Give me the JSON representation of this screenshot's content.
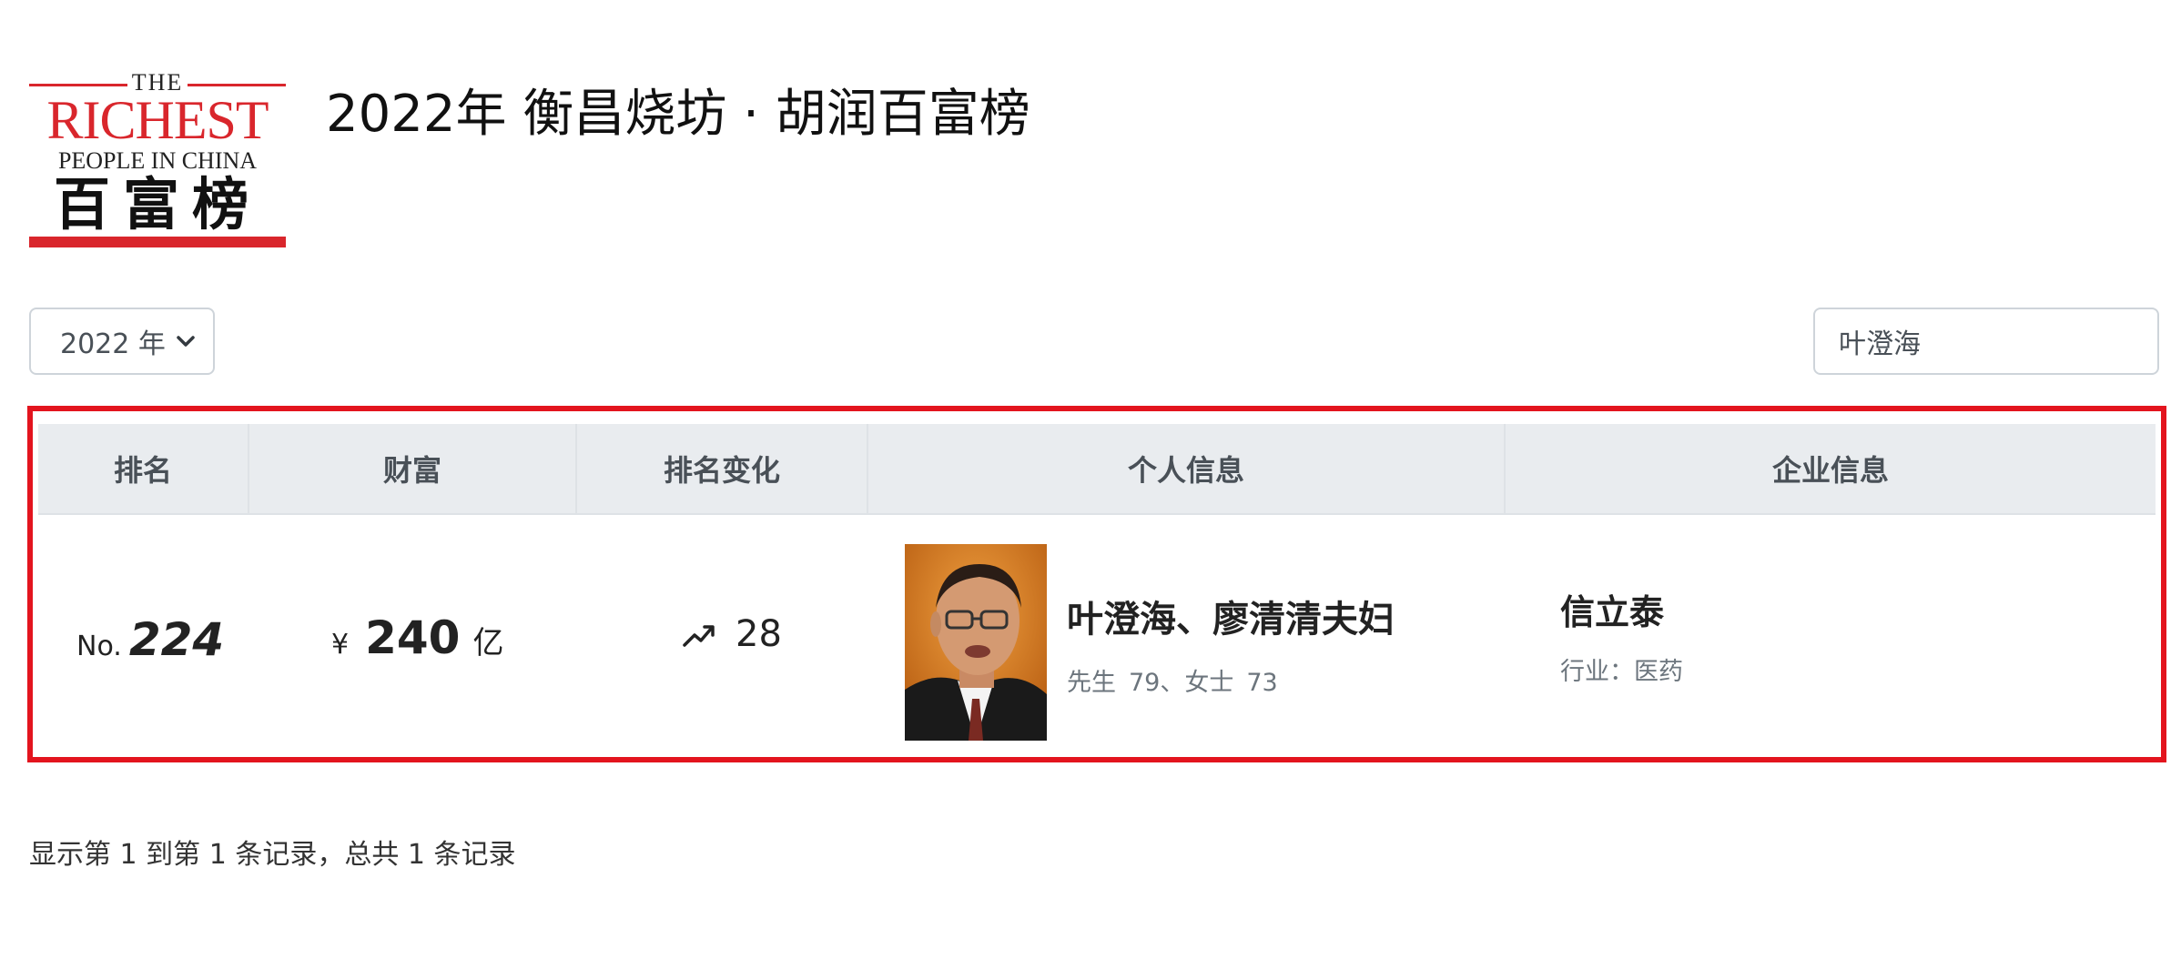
{
  "logo": {
    "the": "THE",
    "richest": "RICHEST",
    "people": "PEOPLE IN CHINA",
    "chinese": "百富榜",
    "accent_color": "#d9262c"
  },
  "header": {
    "title": "2022年 衡昌烧坊 · 胡润百富榜"
  },
  "filters": {
    "year_selected": "2022 年",
    "search_value": "叶澄海",
    "select_icon": "chevron-down-icon"
  },
  "table": {
    "highlight_color": "#e3141e",
    "columns": [
      "排名",
      "财富",
      "排名变化",
      "个人信息",
      "企业信息"
    ],
    "rows": [
      {
        "rank_prefix": "No.",
        "rank": "224",
        "wealth_currency": "¥",
        "wealth_value": "240",
        "wealth_unit": "亿",
        "rank_change_icon": "trend-up-icon",
        "rank_change": "28",
        "person_name": "叶澄海、廖清清夫妇",
        "person_mr": "先生",
        "person_mr_age": "79、",
        "person_ms": "女士",
        "person_ms_age": "73",
        "company_name": "信立泰",
        "industry": "行业：医药"
      }
    ]
  },
  "footer": {
    "summary": "显示第 1 到第 1 条记录，总共 1 条记录"
  }
}
